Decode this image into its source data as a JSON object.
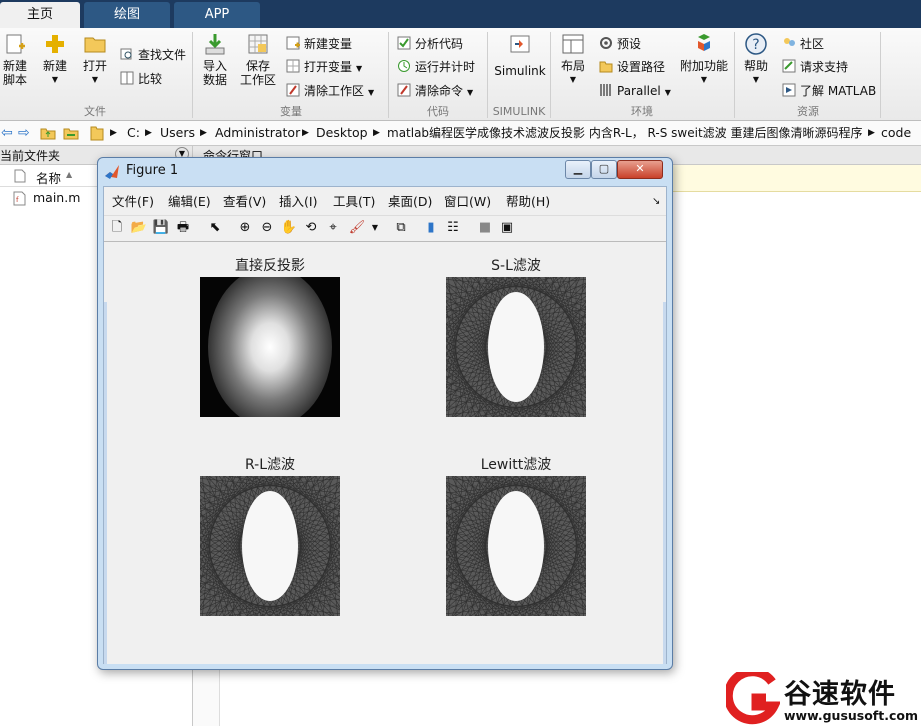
{
  "tabs": [
    {
      "label": "主页",
      "active": true
    },
    {
      "label": "绘图",
      "active": false
    },
    {
      "label": "APP",
      "active": false
    }
  ],
  "ribbon": {
    "file": {
      "group_label": "文件",
      "new_script": "新建\n脚本",
      "new": "新建",
      "open": "打开",
      "find_files": "查找文件",
      "compare": "比较"
    },
    "variable": {
      "group_label": "变量",
      "import_data": "导入\n数据",
      "save_workspace": "保存\n工作区",
      "new_variable": "新建变量",
      "open_variable": "打开变量",
      "clear_workspace": "清除工作区"
    },
    "code": {
      "group_label": "代码",
      "analyze_code": "分析代码",
      "run_and_time": "运行并计时",
      "clear_commands": "清除命令"
    },
    "simulink": {
      "group_label": "SIMULINK",
      "simulink": "Simulink"
    },
    "environment": {
      "group_label": "环境",
      "layout": "布局",
      "preferences": "预设",
      "set_path": "设置路径",
      "parallel": "Parallel",
      "add_ons": "附加功能"
    },
    "resources": {
      "group_label": "资源",
      "help": "帮助",
      "community": "社区",
      "request_support": "请求支持",
      "learn_matlab": "了解 MATLAB"
    }
  },
  "address": {
    "crumbs": [
      "C:",
      "Users",
      "Administrator",
      "Desktop",
      "matlab编程医学成像技术滤波反投影 内含R-L， R-S sweit滤波 重建后图像清晰源码程序",
      "code"
    ]
  },
  "current_folder": {
    "title": "当前文件夹",
    "column_name": "名称",
    "files": [
      "main.m"
    ]
  },
  "command_window": {
    "title": "命令行窗口"
  },
  "figure": {
    "title": "Figure 1",
    "menus": [
      "文件(F)",
      "编辑(E)",
      "查看(V)",
      "插入(I)",
      "工具(T)",
      "桌面(D)",
      "窗口(W)",
      "帮助(H)"
    ],
    "plots": [
      {
        "title": "直接反投影",
        "kind": "blur"
      },
      {
        "title": "S-L滤波",
        "kind": "filtered"
      },
      {
        "title": "R-L滤波",
        "kind": "filtered"
      },
      {
        "title": "Lewitt滤波",
        "kind": "filtered"
      }
    ]
  },
  "watermark": {
    "brand": "谷速软件",
    "url": "www.gususoft.com"
  },
  "colors": {
    "tab_bar": "#1d3a5f",
    "tab_inactive": "#2d5884",
    "watermark_red": "#e02020"
  }
}
